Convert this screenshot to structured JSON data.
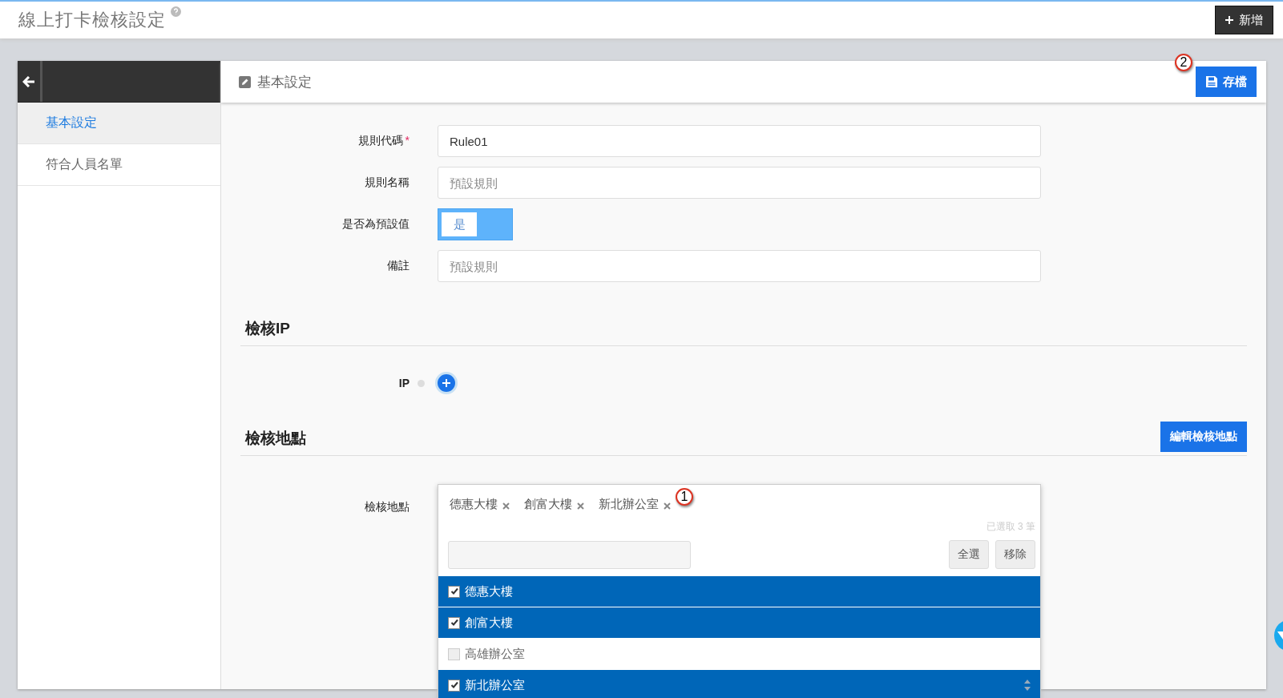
{
  "page": {
    "title": "線上打卡檢核設定",
    "add_button": "新增"
  },
  "sidebar": {
    "items": [
      {
        "label": "基本設定",
        "selected": true
      },
      {
        "label": "符合人員名單",
        "selected": false
      }
    ]
  },
  "panel": {
    "title": "基本設定",
    "save_button": "存檔"
  },
  "form": {
    "fields": [
      {
        "kind": "text",
        "label": "規則代碼",
        "required_mark": "*",
        "value": "Rule01"
      },
      {
        "kind": "text",
        "label": "規則名稱",
        "placeholder": "預設規則"
      },
      {
        "kind": "toggle",
        "label": "是否為預設值",
        "on": true,
        "value": "是"
      },
      {
        "kind": "text",
        "label": "備註",
        "placeholder": "預設規則"
      }
    ]
  },
  "ip_section": {
    "title": "檢核IP",
    "label": "IP"
  },
  "location_section": {
    "title": "檢核地點",
    "edit_button": "編輯檢核地點",
    "label": "檢核地點",
    "tags": [
      "德惠大樓",
      "創富大樓",
      "新北辦公室"
    ],
    "count": "已選取 3 筆",
    "select_all_button": "全選",
    "remove_button": "移除",
    "options": [
      {
        "label": "德惠大樓",
        "checked": true
      },
      {
        "label": "創富大樓",
        "checked": true
      },
      {
        "label": "高雄辦公室",
        "checked": false
      },
      {
        "label": "新北辦公室",
        "checked": true
      }
    ]
  },
  "annotations": [
    "1",
    "2"
  ]
}
